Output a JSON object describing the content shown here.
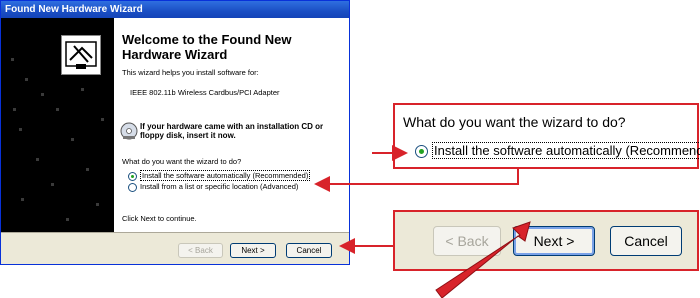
{
  "window": {
    "title": "Found New Hardware Wizard",
    "heading": "Welcome to the Found New Hardware Wizard",
    "help_text": "This wizard helps you install software for:",
    "device_name": "IEEE 802.11b Wireless Cardbus/PCI Adapter",
    "cd_prompt": "If your hardware came with an installation CD or floppy disk, insert it now.",
    "question": "What do you want the wizard to do?",
    "options": [
      {
        "label": "Install the software automatically (Recommended)",
        "selected": true
      },
      {
        "label": "Install from a list or specific location (Advanced)",
        "selected": false
      }
    ],
    "continue_text": "Click Next to continue.",
    "buttons": {
      "back": "< Back",
      "next": "Next >",
      "cancel": "Cancel"
    }
  },
  "callout_question": {
    "question": "What do you want the wizard to do?",
    "option_label": "Install the software automatically (Recommende"
  },
  "callout_buttons": {
    "back": "< Back",
    "next": "Next >",
    "cancel": "Cancel"
  },
  "colors": {
    "callout": "#d8232a",
    "titlebar": "#1a4fc4",
    "radio_dot": "#21a121"
  },
  "icons": [
    "wizard-hardware-icon",
    "cd-icon",
    "arrow-pointer-icon"
  ]
}
